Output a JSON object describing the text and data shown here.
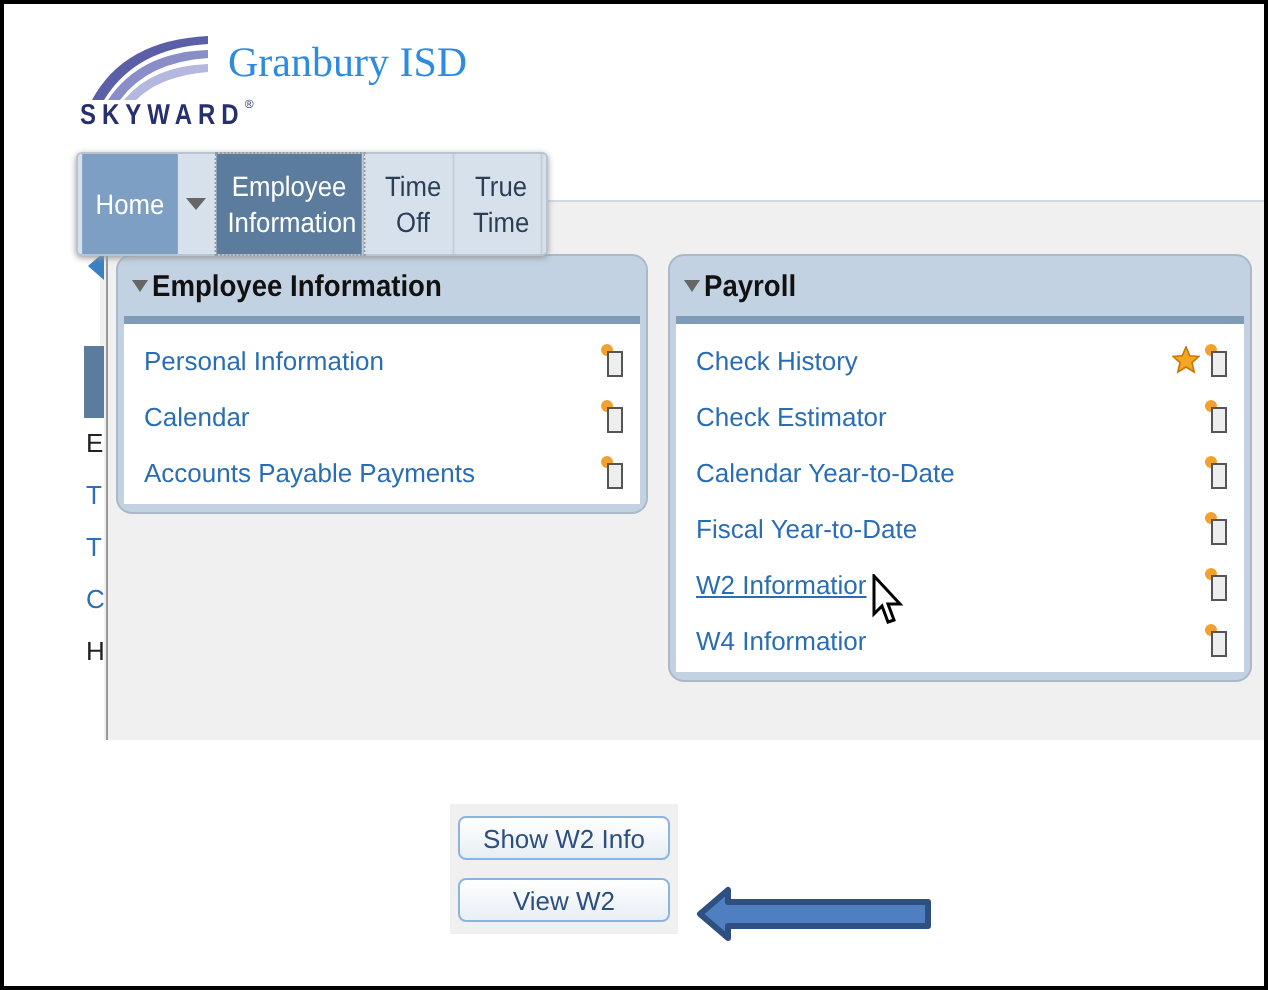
{
  "header": {
    "logo_text": "SKYWARD",
    "logo_mark": "®",
    "district": "Granbury ISD"
  },
  "tabs": [
    {
      "label": "Home",
      "kind": "home",
      "selected": false
    },
    {
      "label": "Employee Information",
      "kind": "tab",
      "selected": true
    },
    {
      "label": "Time Off",
      "kind": "tab",
      "selected": false
    },
    {
      "label": "True Time",
      "kind": "tab",
      "selected": false
    }
  ],
  "sidebar": {
    "items": [
      "E",
      "T",
      "T",
      "C",
      "H"
    ]
  },
  "panels": [
    {
      "title": "Employee Information",
      "items": [
        {
          "label": "Personal Information",
          "hover": false,
          "favorite": false
        },
        {
          "label": "Calendar",
          "hover": false,
          "favorite": false
        },
        {
          "label": "Accounts Payable Payments",
          "hover": false,
          "favorite": false
        }
      ]
    },
    {
      "title": "Payroll",
      "items": [
        {
          "label": "Check History",
          "hover": false,
          "favorite": true
        },
        {
          "label": "Check Estimator",
          "hover": false,
          "favorite": false
        },
        {
          "label": "Calendar Year-to-Date",
          "hover": false,
          "favorite": false
        },
        {
          "label": "Fiscal Year-to-Date",
          "hover": false,
          "favorite": false
        },
        {
          "label": "W2 Informatior",
          "hover": true,
          "favorite": false
        },
        {
          "label": "W4 Informatior",
          "hover": false,
          "favorite": false
        }
      ]
    }
  ],
  "buttons": [
    "Show W2 Info",
    "View W2"
  ]
}
